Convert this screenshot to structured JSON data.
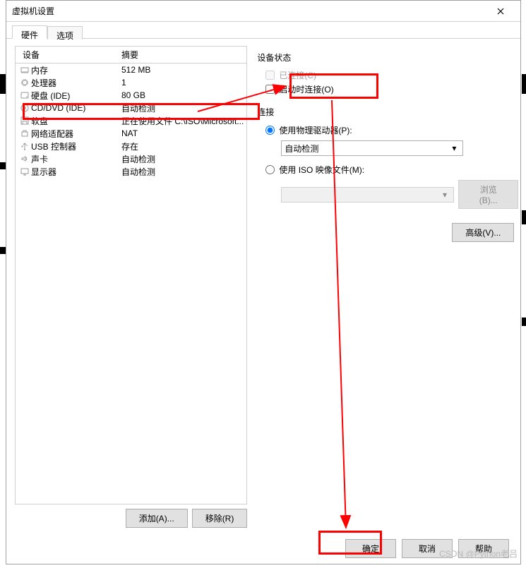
{
  "window": {
    "title": "虚拟机设置"
  },
  "tabs": {
    "hardware": "硬件",
    "options": "选项"
  },
  "device_list": {
    "col_device": "设备",
    "col_summary": "摘要",
    "rows": [
      {
        "icon": "memory",
        "name": "内存",
        "summary": "512 MB"
      },
      {
        "icon": "cpu",
        "name": "处理器",
        "summary": "1"
      },
      {
        "icon": "hdd",
        "name": "硬盘 (IDE)",
        "summary": "80 GB"
      },
      {
        "icon": "cd",
        "name": "CD/DVD (IDE)",
        "summary": "自动检测",
        "selected": true
      },
      {
        "icon": "floppy",
        "name": "软盘",
        "summary": "正在使用文件 C:\\ISO\\Microsoft..."
      },
      {
        "icon": "net",
        "name": "网络适配器",
        "summary": "NAT"
      },
      {
        "icon": "usb",
        "name": "USB 控制器",
        "summary": "存在"
      },
      {
        "icon": "sound",
        "name": "声卡",
        "summary": "自动检测"
      },
      {
        "icon": "display",
        "name": "显示器",
        "summary": "自动检测"
      }
    ]
  },
  "left_buttons": {
    "add": "添加(A)...",
    "remove": "移除(R)"
  },
  "right": {
    "status_title": "设备状态",
    "connected": "已连接(C)",
    "connect_on_power": "启动时连接(O)",
    "connection_title": "连接",
    "use_physical": "使用物理驱动器(P):",
    "physical_value": "自动检测",
    "use_iso": "使用 ISO 映像文件(M):",
    "iso_path": "",
    "browse": "浏览(B)...",
    "advanced": "高级(V)..."
  },
  "bottom": {
    "ok": "确定",
    "cancel": "取消",
    "help": "帮助"
  },
  "watermark": "CSDN @Python老吕"
}
